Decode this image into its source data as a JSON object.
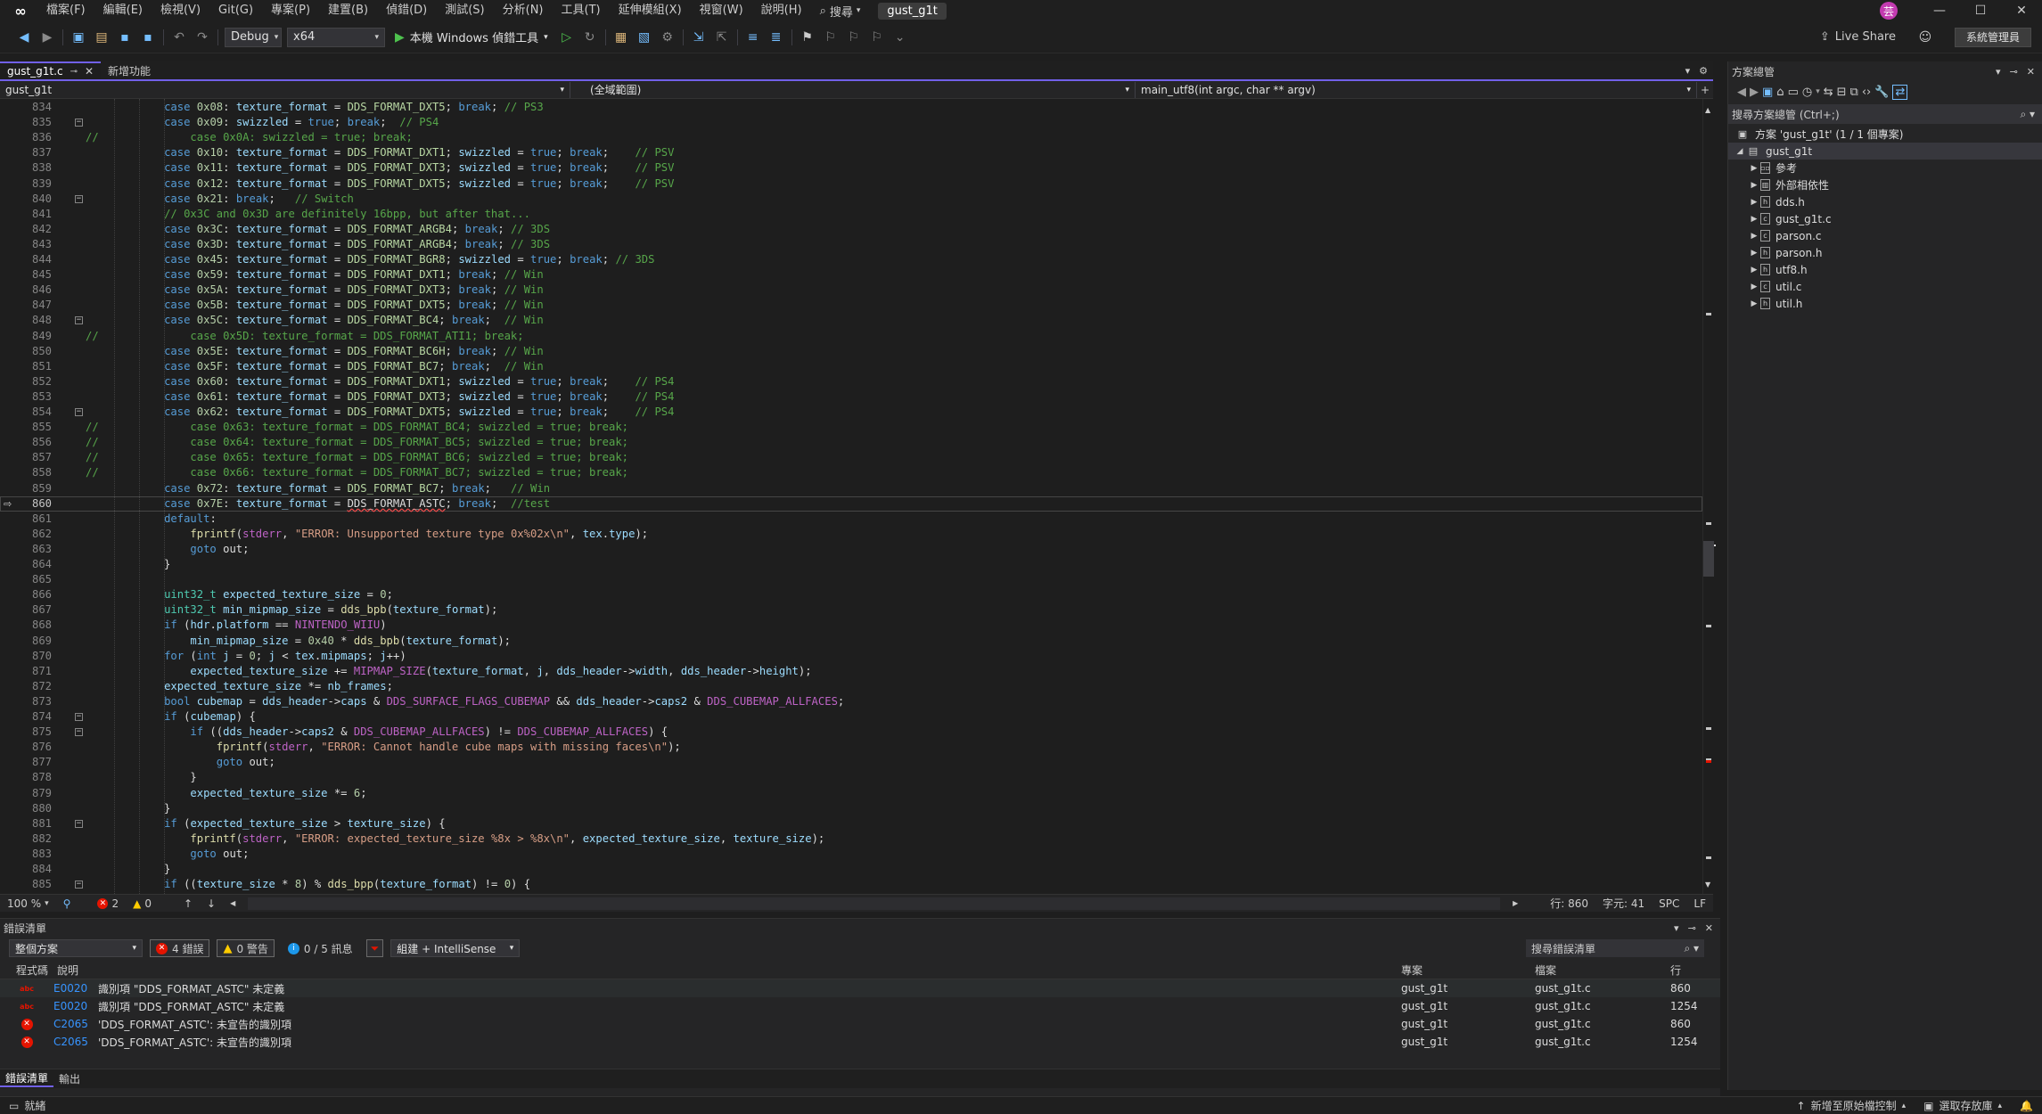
{
  "menubar": {
    "items": [
      "檔案(F)",
      "編輯(E)",
      "檢視(V)",
      "Git(G)",
      "專案(P)",
      "建置(B)",
      "偵錯(D)",
      "測試(S)",
      "分析(N)",
      "工具(T)",
      "延伸模組(X)",
      "視窗(W)",
      "說明(H)"
    ],
    "search_label": "搜尋",
    "solution_title": "gust_g1t",
    "avatar_letter": "芸"
  },
  "toolbar": {
    "configuration": "Debug",
    "platform": "x64",
    "run_label": "本機 Windows 偵錯工具",
    "live_share": "Live Share",
    "admin_label": "系統管理員"
  },
  "tabs": [
    {
      "label": "gust_g1t.c",
      "active": true
    },
    {
      "label": "新增功能",
      "active": false
    }
  ],
  "navbar": {
    "project": "gust_g1t",
    "scope": "(全域範圍)",
    "function": "main_utf8(int argc, char ** argv)"
  },
  "editor": {
    "current_line": 860,
    "lines": [
      {
        "n": 834,
        "html": "            <span class=\"kw\">case</span> <span class=\"num\">0x08</span>: <span class=\"var\">texture_format</span> = <span class=\"en\">DDS_FORMAT_DXT5</span>; <span class=\"kw\">break</span>; <span class=\"cm\">// PS3</span>"
      },
      {
        "n": 835,
        "fold": true,
        "html": "            <span class=\"kw\">case</span> <span class=\"num\">0x09</span>: <span class=\"var\">swizzled</span> = <span class=\"kw\">true</span>; <span class=\"kw\">break</span>;  <span class=\"cm\">// PS4</span>"
      },
      {
        "n": 836,
        "html": "<span class=\"cm\">//              case 0x0A: swizzled = true; break;</span>"
      },
      {
        "n": 837,
        "html": "            <span class=\"kw\">case</span> <span class=\"num\">0x10</span>: <span class=\"var\">texture_format</span> = <span class=\"en\">DDS_FORMAT_DXT1</span>; <span class=\"var\">swizzled</span> = <span class=\"kw\">true</span>; <span class=\"kw\">break</span>;    <span class=\"cm\">// PSV</span>"
      },
      {
        "n": 838,
        "html": "            <span class=\"kw\">case</span> <span class=\"num\">0x11</span>: <span class=\"var\">texture_format</span> = <span class=\"en\">DDS_FORMAT_DXT3</span>; <span class=\"var\">swizzled</span> = <span class=\"kw\">true</span>; <span class=\"kw\">break</span>;    <span class=\"cm\">// PSV</span>"
      },
      {
        "n": 839,
        "html": "            <span class=\"kw\">case</span> <span class=\"num\">0x12</span>: <span class=\"var\">texture_format</span> = <span class=\"en\">DDS_FORMAT_DXT5</span>; <span class=\"var\">swizzled</span> = <span class=\"kw\">true</span>; <span class=\"kw\">break</span>;    <span class=\"cm\">// PSV</span>"
      },
      {
        "n": 840,
        "fold": true,
        "html": "            <span class=\"kw\">case</span> <span class=\"num\">0x21</span>: <span class=\"kw\">break</span>;   <span class=\"cm\">// Switch</span>"
      },
      {
        "n": 841,
        "html": "            <span class=\"cm\">// 0x3C and 0x3D are definitely 16bpp, but after that...</span>"
      },
      {
        "n": 842,
        "html": "            <span class=\"kw\">case</span> <span class=\"num\">0x3C</span>: <span class=\"var\">texture_format</span> = <span class=\"en\">DDS_FORMAT_ARGB4</span>; <span class=\"kw\">break</span>; <span class=\"cm\">// 3DS</span>"
      },
      {
        "n": 843,
        "html": "            <span class=\"kw\">case</span> <span class=\"num\">0x3D</span>: <span class=\"var\">texture_format</span> = <span class=\"en\">DDS_FORMAT_ARGB4</span>; <span class=\"kw\">break</span>; <span class=\"cm\">// 3DS</span>"
      },
      {
        "n": 844,
        "html": "            <span class=\"kw\">case</span> <span class=\"num\">0x45</span>: <span class=\"var\">texture_format</span> = <span class=\"en\">DDS_FORMAT_BGR8</span>; <span class=\"var\">swizzled</span> = <span class=\"kw\">true</span>; <span class=\"kw\">break</span>; <span class=\"cm\">// 3DS</span>"
      },
      {
        "n": 845,
        "html": "            <span class=\"kw\">case</span> <span class=\"num\">0x59</span>: <span class=\"var\">texture_format</span> = <span class=\"en\">DDS_FORMAT_DXT1</span>; <span class=\"kw\">break</span>; <span class=\"cm\">// Win</span>"
      },
      {
        "n": 846,
        "html": "            <span class=\"kw\">case</span> <span class=\"num\">0x5A</span>: <span class=\"var\">texture_format</span> = <span class=\"en\">DDS_FORMAT_DXT3</span>; <span class=\"kw\">break</span>; <span class=\"cm\">// Win</span>"
      },
      {
        "n": 847,
        "html": "            <span class=\"kw\">case</span> <span class=\"num\">0x5B</span>: <span class=\"var\">texture_format</span> = <span class=\"en\">DDS_FORMAT_DXT5</span>; <span class=\"kw\">break</span>; <span class=\"cm\">// Win</span>"
      },
      {
        "n": 848,
        "fold": true,
        "html": "            <span class=\"kw\">case</span> <span class=\"num\">0x5C</span>: <span class=\"var\">texture_format</span> = <span class=\"en\">DDS_FORMAT_BC4</span>; <span class=\"kw\">break</span>;  <span class=\"cm\">// Win</span>"
      },
      {
        "n": 849,
        "html": "<span class=\"cm\">//              case 0x5D: texture_format = DDS_FORMAT_ATI1; break;</span>"
      },
      {
        "n": 850,
        "html": "            <span class=\"kw\">case</span> <span class=\"num\">0x5E</span>: <span class=\"var\">texture_format</span> = <span class=\"en\">DDS_FORMAT_BC6H</span>; <span class=\"kw\">break</span>; <span class=\"cm\">// Win</span>"
      },
      {
        "n": 851,
        "html": "            <span class=\"kw\">case</span> <span class=\"num\">0x5F</span>: <span class=\"var\">texture_format</span> = <span class=\"en\">DDS_FORMAT_BC7</span>; <span class=\"kw\">break</span>;  <span class=\"cm\">// Win</span>"
      },
      {
        "n": 852,
        "html": "            <span class=\"kw\">case</span> <span class=\"num\">0x60</span>: <span class=\"var\">texture_format</span> = <span class=\"en\">DDS_FORMAT_DXT1</span>; <span class=\"var\">swizzled</span> = <span class=\"kw\">true</span>; <span class=\"kw\">break</span>;    <span class=\"cm\">// PS4</span>"
      },
      {
        "n": 853,
        "html": "            <span class=\"kw\">case</span> <span class=\"num\">0x61</span>: <span class=\"var\">texture_format</span> = <span class=\"en\">DDS_FORMAT_DXT3</span>; <span class=\"var\">swizzled</span> = <span class=\"kw\">true</span>; <span class=\"kw\">break</span>;    <span class=\"cm\">// PS4</span>"
      },
      {
        "n": 854,
        "fold": true,
        "html": "            <span class=\"kw\">case</span> <span class=\"num\">0x62</span>: <span class=\"var\">texture_format</span> = <span class=\"en\">DDS_FORMAT_DXT5</span>; <span class=\"var\">swizzled</span> = <span class=\"kw\">true</span>; <span class=\"kw\">break</span>;    <span class=\"cm\">// PS4</span>"
      },
      {
        "n": 855,
        "html": "<span class=\"cm\">//              case 0x63: texture_format = DDS_FORMAT_BC4; swizzled = true; break;</span>"
      },
      {
        "n": 856,
        "html": "<span class=\"cm\">//              case 0x64: texture_format = DDS_FORMAT_BC5; swizzled = true; break;</span>"
      },
      {
        "n": 857,
        "html": "<span class=\"cm\">//              case 0x65: texture_format = DDS_FORMAT_BC6; swizzled = true; break;</span>"
      },
      {
        "n": 858,
        "html": "<span class=\"cm\">//              case 0x66: texture_format = DDS_FORMAT_BC7; swizzled = true; break;</span>"
      },
      {
        "n": 859,
        "html": "            <span class=\"kw\">case</span> <span class=\"num\">0x72</span>: <span class=\"var\">texture_format</span> = <span class=\"en\">DDS_FORMAT_BC7</span>; <span class=\"kw\">break</span>;   <span class=\"cm\">// Win</span>"
      },
      {
        "n": 860,
        "html": "            <span class=\"kw\">case</span> <span class=\"num\">0x7E</span>: <span class=\"var\">texture_format</span> = <span class=\"err\">DDS_FORMAT_ASTC</span>; <span class=\"kw\">break</span>;  <span class=\"cm\">//test</span>"
      },
      {
        "n": 861,
        "html": "            <span class=\"kw\">default</span>:"
      },
      {
        "n": 862,
        "html": "                <span class=\"fn\">fprintf</span>(<span class=\"mac\">stderr</span>, <span class=\"str\">\"ERROR: Unsupported texture type 0x%02x\\n\"</span>, <span class=\"var\">tex</span>.<span class=\"var\">type</span>);"
      },
      {
        "n": 863,
        "html": "                <span class=\"kw\">goto</span> out;"
      },
      {
        "n": 864,
        "html": "            }"
      },
      {
        "n": 865,
        "html": ""
      },
      {
        "n": 866,
        "html": "            <span class=\"ty\">uint32_t</span> <span class=\"var\">expected_texture_size</span> = <span class=\"num\">0</span>;"
      },
      {
        "n": 867,
        "html": "            <span class=\"ty\">uint32_t</span> <span class=\"var\">min_mipmap_size</span> = <span class=\"fn\">dds_bpb</span>(<span class=\"var\">texture_format</span>);"
      },
      {
        "n": 868,
        "html": "            <span class=\"kw\">if</span> (<span class=\"var\">hdr</span>.<span class=\"var\">platform</span> == <span class=\"mac\">NINTENDO_WIIU</span>)"
      },
      {
        "n": 869,
        "html": "                <span class=\"var\">min_mipmap_size</span> = <span class=\"num\">0x40</span> * <span class=\"fn\">dds_bpb</span>(<span class=\"var\">texture_format</span>);"
      },
      {
        "n": 870,
        "html": "            <span class=\"kw\">for</span> (<span class=\"kw\">int</span> <span class=\"var\">j</span> = <span class=\"num\">0</span>; <span class=\"var\">j</span> &lt; <span class=\"var\">tex</span>.<span class=\"var\">mipmaps</span>; <span class=\"var\">j</span>++)"
      },
      {
        "n": 871,
        "html": "                <span class=\"var\">expected_texture_size</span> += <span class=\"mac\">MIPMAP_SIZE</span>(<span class=\"var\">texture_format</span>, <span class=\"var\">j</span>, <span class=\"var\">dds_header</span>-&gt;<span class=\"var\">width</span>, <span class=\"var\">dds_header</span>-&gt;<span class=\"var\">height</span>);"
      },
      {
        "n": 872,
        "html": "            <span class=\"var\">expected_texture_size</span> *= <span class=\"var\">nb_frames</span>;"
      },
      {
        "n": 873,
        "html": "            <span class=\"kw\">bool</span> <span class=\"var\">cubemap</span> = <span class=\"var\">dds_header</span>-&gt;<span class=\"var\">caps</span> &amp; <span class=\"mac\">DDS_SURFACE_FLAGS_CUBEMAP</span> &amp;&amp; <span class=\"var\">dds_header</span>-&gt;<span class=\"var\">caps2</span> &amp; <span class=\"mac\">DDS_CUBEMAP_ALLFACES</span>;"
      },
      {
        "n": 874,
        "fold": true,
        "html": "            <span class=\"kw\">if</span> (<span class=\"var\">cubemap</span>) {"
      },
      {
        "n": 875,
        "fold": true,
        "html": "                <span class=\"kw\">if</span> ((<span class=\"var\">dds_header</span>-&gt;<span class=\"var\">caps2</span> &amp; <span class=\"mac\">DDS_CUBEMAP_ALLFACES</span>) != <span class=\"mac\">DDS_CUBEMAP_ALLFACES</span>) {"
      },
      {
        "n": 876,
        "html": "                    <span class=\"fn\">fprintf</span>(<span class=\"mac\">stderr</span>, <span class=\"str\">\"ERROR: Cannot handle cube maps with missing faces\\n\"</span>);"
      },
      {
        "n": 877,
        "html": "                    <span class=\"kw\">goto</span> out;"
      },
      {
        "n": 878,
        "html": "                }"
      },
      {
        "n": 879,
        "html": "                <span class=\"var\">expected_texture_size</span> *= <span class=\"num\">6</span>;"
      },
      {
        "n": 880,
        "html": "            }"
      },
      {
        "n": 881,
        "fold": true,
        "html": "            <span class=\"kw\">if</span> (<span class=\"var\">expected_texture_size</span> &gt; <span class=\"var\">texture_size</span>) {"
      },
      {
        "n": 882,
        "html": "                <span class=\"fn\">fprintf</span>(<span class=\"mac\">stderr</span>, <span class=\"str\">\"ERROR: expected_texture_size %8x &gt; %8x\\n\"</span>, <span class=\"var\">expected_texture_size</span>, <span class=\"var\">texture_size</span>);"
      },
      {
        "n": 883,
        "html": "                <span class=\"kw\">goto</span> out;"
      },
      {
        "n": 884,
        "html": "            }"
      },
      {
        "n": 885,
        "fold": true,
        "html": "            <span class=\"kw\">if</span> ((<span class=\"var\">texture_size</span> * <span class=\"num\">8</span>) % <span class=\"fn\">dds_bpp</span>(<span class=\"var\">texture_format</span>) != <span class=\"num\">0</span>) {"
      }
    ]
  },
  "editor_status": {
    "zoom": "100 %",
    "errors": "2",
    "warnings": "0",
    "line": "行: 860",
    "col": "字元: 41",
    "spc": "SPC",
    "eol": "LF"
  },
  "solution_explorer": {
    "title": "方案總管",
    "search_placeholder": "搜尋方案總管 (Ctrl+;)",
    "solution_label": "方案 'gust_g1t' (1 / 1 個專案)",
    "project": "gust_g1t",
    "children": [
      "參考",
      "外部相依性",
      "dds.h",
      "gust_g1t.c",
      "parson.c",
      "parson.h",
      "utf8.h",
      "util.c",
      "util.h"
    ]
  },
  "error_list": {
    "title": "錯誤清單",
    "scope": "整個方案",
    "errors_badge": "4 錯誤",
    "warnings_badge": "0 警告",
    "messages_badge": "0 / 5 訊息",
    "source": "組建 + IntelliSense",
    "search_placeholder": "搜尋錯誤清單",
    "headers": {
      "code": "程式碼",
      "desc": "說明",
      "project": "專案",
      "file": "檔案",
      "line": "行"
    },
    "rows": [
      {
        "kind": "intellisense",
        "code": "E0020",
        "desc": "識別項 \"DDS_FORMAT_ASTC\" 未定義",
        "project": "gust_g1t",
        "file": "gust_g1t.c",
        "line": "860"
      },
      {
        "kind": "intellisense",
        "code": "E0020",
        "desc": "識別項 \"DDS_FORMAT_ASTC\" 未定義",
        "project": "gust_g1t",
        "file": "gust_g1t.c",
        "line": "1254"
      },
      {
        "kind": "build",
        "code": "C2065",
        "desc": "'DDS_FORMAT_ASTC': 未宣告的識別項",
        "project": "gust_g1t",
        "file": "gust_g1t.c",
        "line": "860"
      },
      {
        "kind": "build",
        "code": "C2065",
        "desc": "'DDS_FORMAT_ASTC': 未宣告的識別項",
        "project": "gust_g1t",
        "file": "gust_g1t.c",
        "line": "1254"
      }
    ]
  },
  "bottom_tabs": [
    "錯誤清單",
    "輸出"
  ],
  "statusbar": {
    "ready": "就緒",
    "add_source": "新增至原始檔控制",
    "select_repo": "選取存放庫"
  }
}
